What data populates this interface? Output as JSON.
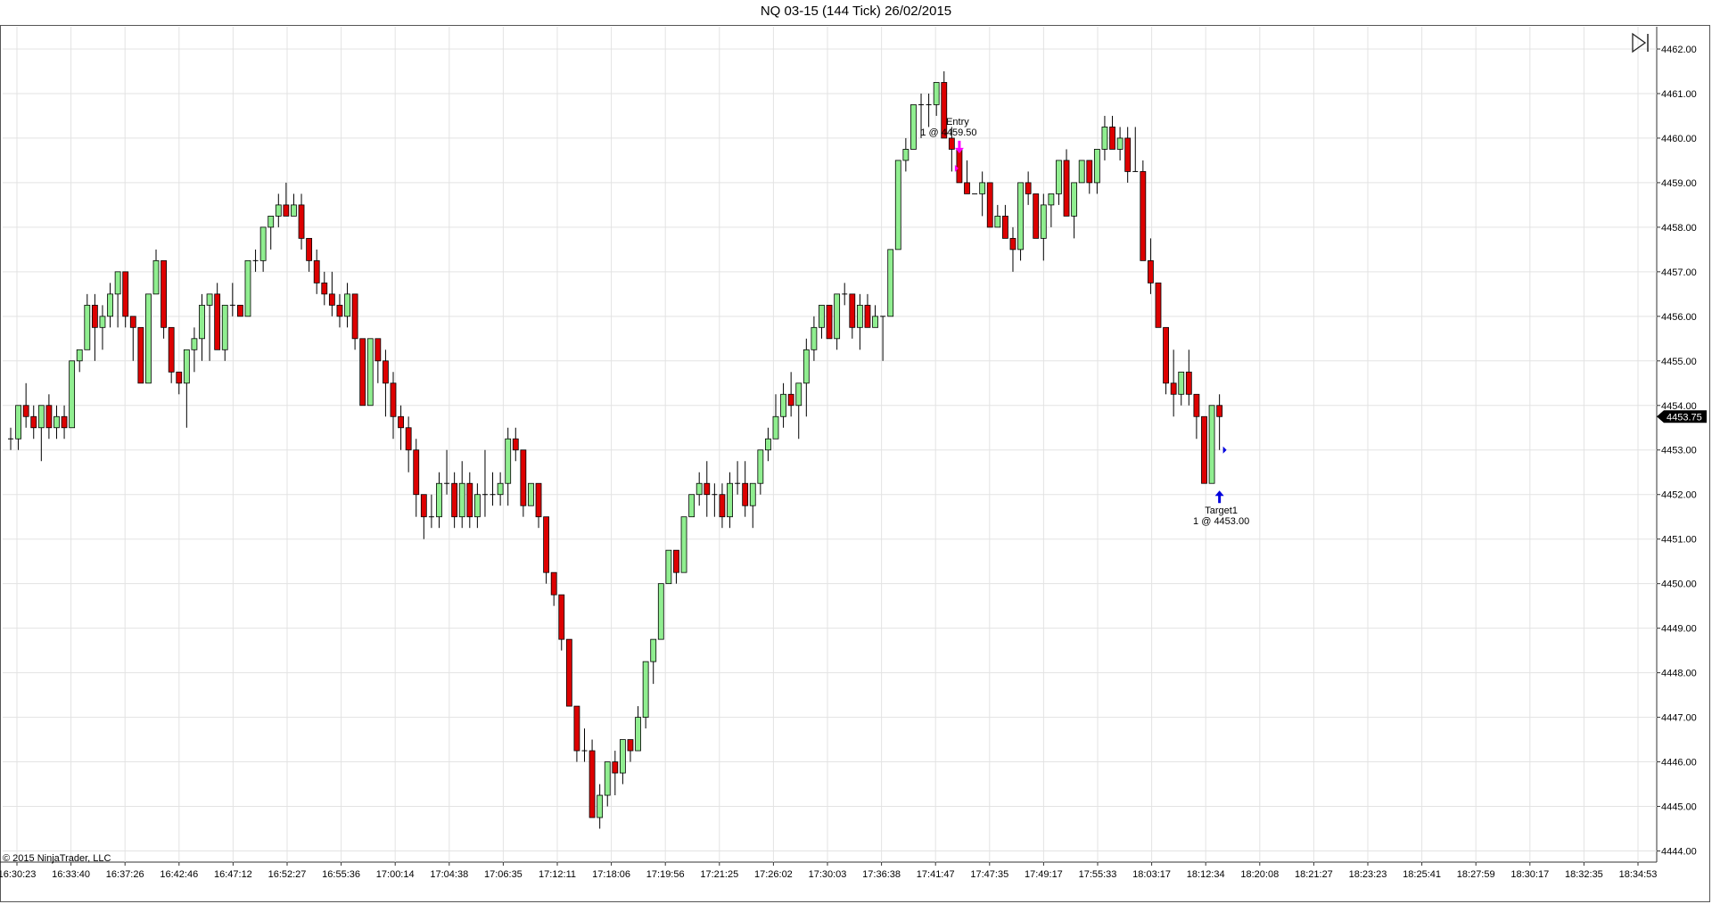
{
  "window": {
    "title": "NQ 03-15 (144 Tick)  26/02/2015"
  },
  "copyright": "© 2015 NinjaTrader, LLC",
  "icons": {
    "scroll_end": "skip-to-end-icon"
  },
  "chart_data": {
    "type": "candlestick",
    "title": "NQ 03-15 (144 Tick)  26/02/2015",
    "ylim": [
      4443.75,
      4462.5
    ],
    "y_ticks": [
      "4444.00",
      "4445.00",
      "4446.00",
      "4447.00",
      "4448.00",
      "4449.00",
      "4450.00",
      "4451.00",
      "4452.00",
      "4453.00",
      "4454.00",
      "4455.00",
      "4456.00",
      "4457.00",
      "4458.00",
      "4459.00",
      "4460.00",
      "4461.00",
      "4462.00"
    ],
    "x_ticks": [
      "16:30:23",
      "16:33:40",
      "16:37:26",
      "16:42:46",
      "16:47:12",
      "16:52:27",
      "16:55:36",
      "17:00:14",
      "17:04:38",
      "17:06:35",
      "17:12:11",
      "17:18:06",
      "17:19:56",
      "17:21:25",
      "17:26:02",
      "17:30:03",
      "17:36:38",
      "17:41:47",
      "17:47:35",
      "17:49:17",
      "17:55:33",
      "18:03:17",
      "18:12:34",
      "18:20:08",
      "18:21:27",
      "18:23:23",
      "18:25:41",
      "18:27:59",
      "18:30:17",
      "18:32:35",
      "18:34:53"
    ],
    "last_price": "4453.75",
    "grid": true,
    "up_color": "#90ee90",
    "down_color": "#dd0000",
    "candles": [
      [
        4453.25,
        4453.5,
        4453.0,
        4453.25
      ],
      [
        4453.25,
        4454.0,
        4453.0,
        4454.0
      ],
      [
        4454.0,
        4454.5,
        4453.5,
        4453.75
      ],
      [
        4453.75,
        4454.0,
        4453.25,
        4453.5
      ],
      [
        4453.5,
        4454.0,
        4452.75,
        4454.0
      ],
      [
        4454.0,
        4454.25,
        4453.25,
        4453.5
      ],
      [
        4453.5,
        4454.0,
        4453.25,
        4453.75
      ],
      [
        4453.75,
        4454.0,
        4453.25,
        4453.5
      ],
      [
        4453.5,
        4455.0,
        4453.5,
        4455.0
      ],
      [
        4455.0,
        4455.25,
        4454.75,
        4455.25
      ],
      [
        4455.25,
        4456.5,
        4455.25,
        4456.25
      ],
      [
        4456.25,
        4456.5,
        4455.0,
        4455.75
      ],
      [
        4455.75,
        4456.25,
        4455.25,
        4456.0
      ],
      [
        4456.0,
        4456.75,
        4455.75,
        4456.5
      ],
      [
        4456.5,
        4457.0,
        4455.75,
        4457.0
      ],
      [
        4457.0,
        4457.0,
        4455.75,
        4456.0
      ],
      [
        4456.0,
        4456.0,
        4455.0,
        4455.75
      ],
      [
        4455.75,
        4455.75,
        4454.5,
        4454.5
      ],
      [
        4454.5,
        4456.5,
        4454.5,
        4456.5
      ],
      [
        4456.5,
        4457.5,
        4456.5,
        4457.25
      ],
      [
        4457.25,
        4457.25,
        4455.5,
        4455.75
      ],
      [
        4455.75,
        4455.75,
        4454.5,
        4454.75
      ],
      [
        4454.75,
        4454.75,
        4454.25,
        4454.5
      ],
      [
        4454.5,
        4455.25,
        4453.5,
        4455.25
      ],
      [
        4455.25,
        4455.75,
        4454.75,
        4455.5
      ],
      [
        4455.5,
        4456.5,
        4455.0,
        4456.25
      ],
      [
        4456.25,
        4456.5,
        4455.0,
        4456.5
      ],
      [
        4456.5,
        4456.75,
        4455.25,
        4455.25
      ],
      [
        4455.25,
        4456.25,
        4455.0,
        4456.25
      ],
      [
        4456.25,
        4456.75,
        4456.0,
        4456.25
      ],
      [
        4456.25,
        4456.25,
        4456.0,
        4456.0
      ],
      [
        4456.0,
        4457.25,
        4456.0,
        4457.25
      ],
      [
        4457.25,
        4457.5,
        4457.0,
        4457.25
      ],
      [
        4457.25,
        4458.0,
        4457.0,
        4458.0
      ],
      [
        4458.0,
        4458.25,
        4457.5,
        4458.25
      ],
      [
        4458.25,
        4458.75,
        4458.0,
        4458.5
      ],
      [
        4458.5,
        4459.0,
        4458.25,
        4458.25
      ],
      [
        4458.25,
        4458.75,
        4458.25,
        4458.5
      ],
      [
        4458.5,
        4458.75,
        4457.5,
        4457.75
      ],
      [
        4457.75,
        4457.75,
        4457.0,
        4457.25
      ],
      [
        4457.25,
        4457.5,
        4456.5,
        4456.75
      ],
      [
        4456.75,
        4457.0,
        4456.25,
        4456.5
      ],
      [
        4456.5,
        4457.0,
        4456.0,
        4456.25
      ],
      [
        4456.25,
        4456.5,
        4455.75,
        4456.0
      ],
      [
        4456.0,
        4456.75,
        4455.75,
        4456.5
      ],
      [
        4456.5,
        4456.5,
        4455.25,
        4455.5
      ],
      [
        4455.5,
        4455.5,
        4454.0,
        4454.0
      ],
      [
        4454.0,
        4455.5,
        4454.0,
        4455.5
      ],
      [
        4455.5,
        4455.5,
        4454.5,
        4455.0
      ],
      [
        4455.0,
        4455.25,
        4453.75,
        4454.5
      ],
      [
        4454.5,
        4454.75,
        4453.25,
        4453.75
      ],
      [
        4453.75,
        4454.0,
        4453.0,
        4453.5
      ],
      [
        4453.5,
        4453.75,
        4452.5,
        4453.0
      ],
      [
        4453.0,
        4453.25,
        4451.5,
        4452.0
      ],
      [
        4452.0,
        4452.0,
        4451.0,
        4451.5
      ],
      [
        4451.5,
        4452.0,
        4451.25,
        4451.5
      ],
      [
        4451.5,
        4452.5,
        4451.25,
        4452.25
      ],
      [
        4452.25,
        4453.0,
        4452.0,
        4452.25
      ],
      [
        4452.25,
        4452.5,
        4451.25,
        4451.5
      ],
      [
        4451.5,
        4452.75,
        4451.25,
        4452.25
      ],
      [
        4452.25,
        4452.5,
        4451.25,
        4451.5
      ],
      [
        4451.5,
        4452.25,
        4451.25,
        4452.0
      ],
      [
        4452.0,
        4453.0,
        4451.5,
        4452.0
      ],
      [
        4452.0,
        4452.5,
        4451.75,
        4452.0
      ],
      [
        4452.0,
        4452.5,
        4451.75,
        4452.25
      ],
      [
        4452.25,
        4453.5,
        4451.75,
        4453.25
      ],
      [
        4453.25,
        4453.5,
        4452.75,
        4453.0
      ],
      [
        4453.0,
        4453.0,
        4451.5,
        4451.75
      ],
      [
        4451.75,
        4452.25,
        4451.75,
        4452.25
      ],
      [
        4452.25,
        4452.25,
        4451.25,
        4451.5
      ],
      [
        4451.5,
        4451.5,
        4450.0,
        4450.25
      ],
      [
        4450.25,
        4450.25,
        4449.5,
        4449.75
      ],
      [
        4449.75,
        4449.75,
        4448.5,
        4448.75
      ],
      [
        4448.75,
        4448.75,
        4447.25,
        4447.25
      ],
      [
        4447.25,
        4447.25,
        4446.0,
        4446.25
      ],
      [
        4446.25,
        4446.75,
        4446.0,
        4446.25
      ],
      [
        4446.25,
        4446.5,
        4444.75,
        4444.75
      ],
      [
        4444.75,
        4445.5,
        4444.5,
        4445.25
      ],
      [
        4445.25,
        4446.0,
        4445.0,
        4446.0
      ],
      [
        4446.0,
        4446.25,
        4445.25,
        4445.75
      ],
      [
        4445.75,
        4446.5,
        4445.5,
        4446.5
      ],
      [
        4446.5,
        4446.5,
        4446.0,
        4446.25
      ],
      [
        4446.25,
        4447.25,
        4446.25,
        4447.0
      ],
      [
        4447.0,
        4448.25,
        4446.75,
        4448.25
      ],
      [
        4448.25,
        4448.75,
        4447.75,
        4448.75
      ],
      [
        4448.75,
        4450.0,
        4448.75,
        4450.0
      ],
      [
        4450.0,
        4450.75,
        4450.0,
        4450.75
      ],
      [
        4450.75,
        4450.75,
        4450.0,
        4450.25
      ],
      [
        4450.25,
        4451.5,
        4450.25,
        4451.5
      ],
      [
        4451.5,
        4452.0,
        4451.5,
        4452.0
      ],
      [
        4452.0,
        4452.5,
        4451.75,
        4452.25
      ],
      [
        4452.25,
        4452.75,
        4451.5,
        4452.0
      ],
      [
        4452.0,
        4452.25,
        4451.5,
        4452.0
      ],
      [
        4452.0,
        4452.25,
        4451.25,
        4451.5
      ],
      [
        4451.5,
        4452.5,
        4451.25,
        4452.25
      ],
      [
        4452.25,
        4452.75,
        4452.0,
        4452.25
      ],
      [
        4452.25,
        4452.75,
        4451.5,
        4451.75
      ],
      [
        4451.75,
        4452.25,
        4451.25,
        4452.25
      ],
      [
        4452.25,
        4453.0,
        4452.0,
        4453.0
      ],
      [
        4453.0,
        4453.5,
        4452.75,
        4453.25
      ],
      [
        4453.25,
        4454.25,
        4453.25,
        4453.75
      ],
      [
        4453.75,
        4454.5,
        4453.5,
        4454.25
      ],
      [
        4454.25,
        4454.75,
        4453.75,
        4454.0
      ],
      [
        4454.0,
        4454.5,
        4453.25,
        4454.5
      ],
      [
        4454.5,
        4455.5,
        4453.75,
        4455.25
      ],
      [
        4455.25,
        4456.0,
        4455.0,
        4455.75
      ],
      [
        4455.75,
        4456.25,
        4455.5,
        4456.25
      ],
      [
        4456.25,
        4456.25,
        4455.5,
        4455.5
      ],
      [
        4455.5,
        4456.5,
        4455.25,
        4456.5
      ],
      [
        4456.5,
        4456.75,
        4456.25,
        4456.5
      ],
      [
        4456.5,
        4456.5,
        4455.5,
        4455.75
      ],
      [
        4455.75,
        4456.5,
        4455.25,
        4456.25
      ],
      [
        4456.25,
        4456.5,
        4455.75,
        4455.75
      ],
      [
        4455.75,
        4456.25,
        4455.75,
        4456.0
      ],
      [
        4456.0,
        4456.0,
        4455.0,
        4456.0
      ],
      [
        4456.0,
        4457.5,
        4456.0,
        4457.5
      ],
      [
        4457.5,
        4459.5,
        4457.5,
        4459.5
      ],
      [
        4459.5,
        4460.0,
        4459.25,
        4459.75
      ],
      [
        4459.75,
        4460.75,
        4459.75,
        4460.75
      ],
      [
        4460.75,
        4461.0,
        4460.0,
        4460.75
      ],
      [
        4460.75,
        4461.0,
        4460.25,
        4460.75
      ],
      [
        4460.75,
        4461.25,
        4460.5,
        4461.25
      ],
      [
        4461.25,
        4461.5,
        4460.0,
        4460.0
      ],
      [
        4460.0,
        4460.25,
        4459.25,
        4459.75
      ],
      [
        4459.75,
        4459.75,
        4459.0,
        4459.0
      ],
      [
        4459.0,
        4459.5,
        4458.75,
        4458.75
      ],
      [
        4458.75,
        4458.75,
        4458.75,
        4458.75
      ],
      [
        4458.75,
        4459.25,
        4458.25,
        4459.0
      ],
      [
        4459.0,
        4459.0,
        4458.0,
        4458.0
      ],
      [
        4458.0,
        4458.5,
        4458.0,
        4458.25
      ],
      [
        4458.25,
        4458.5,
        4457.75,
        4457.75
      ],
      [
        4457.75,
        4458.0,
        4457.0,
        4457.5
      ],
      [
        4457.5,
        4459.0,
        4457.25,
        4459.0
      ],
      [
        4459.0,
        4459.25,
        4458.5,
        4458.75
      ],
      [
        4458.75,
        4458.75,
        4457.75,
        4457.75
      ],
      [
        4457.75,
        4458.75,
        4457.25,
        4458.5
      ],
      [
        4458.5,
        4458.75,
        4458.0,
        4458.75
      ],
      [
        4458.75,
        4459.5,
        4458.5,
        4459.5
      ],
      [
        4459.5,
        4459.75,
        4458.25,
        4458.25
      ],
      [
        4458.25,
        4459.0,
        4457.75,
        4459.0
      ],
      [
        4459.0,
        4459.5,
        4459.0,
        4459.5
      ],
      [
        4459.5,
        4459.5,
        4458.75,
        4459.0
      ],
      [
        4459.0,
        4459.75,
        4458.75,
        4459.75
      ],
      [
        4459.75,
        4460.5,
        4459.5,
        4460.25
      ],
      [
        4460.25,
        4460.5,
        4459.75,
        4459.75
      ],
      [
        4459.75,
        4460.25,
        4459.5,
        4460.0
      ],
      [
        4460.0,
        4460.25,
        4459.0,
        4459.25
      ],
      [
        4459.25,
        4460.25,
        4459.25,
        4459.25
      ],
      [
        4459.25,
        4459.5,
        4457.25,
        4457.25
      ],
      [
        4457.25,
        4457.75,
        4456.5,
        4456.75
      ],
      [
        4456.75,
        4456.75,
        4455.75,
        4455.75
      ],
      [
        4455.75,
        4455.75,
        4454.25,
        4454.5
      ],
      [
        4454.5,
        4455.25,
        4453.75,
        4454.25
      ],
      [
        4454.25,
        4454.75,
        4454.0,
        4454.75
      ],
      [
        4454.75,
        4455.25,
        4454.0,
        4454.25
      ],
      [
        4454.25,
        4454.25,
        4453.25,
        4453.75
      ],
      [
        4453.75,
        4453.75,
        4452.25,
        4452.25
      ],
      [
        4452.25,
        4454.0,
        4452.25,
        4454.0
      ],
      [
        4454.0,
        4454.25,
        4453.0,
        4453.75
      ]
    ],
    "annotations": [
      {
        "label": "Entry",
        "detail": "1 @ 4459.50",
        "bar": 124,
        "price": 4459.5,
        "direction": "sell",
        "color": "#ff00ff"
      },
      {
        "label": "Target1",
        "detail": "1 @ 4453.00",
        "bar": 158,
        "price": 4453.0,
        "direction": "buy",
        "color": "#0000dd"
      }
    ]
  }
}
